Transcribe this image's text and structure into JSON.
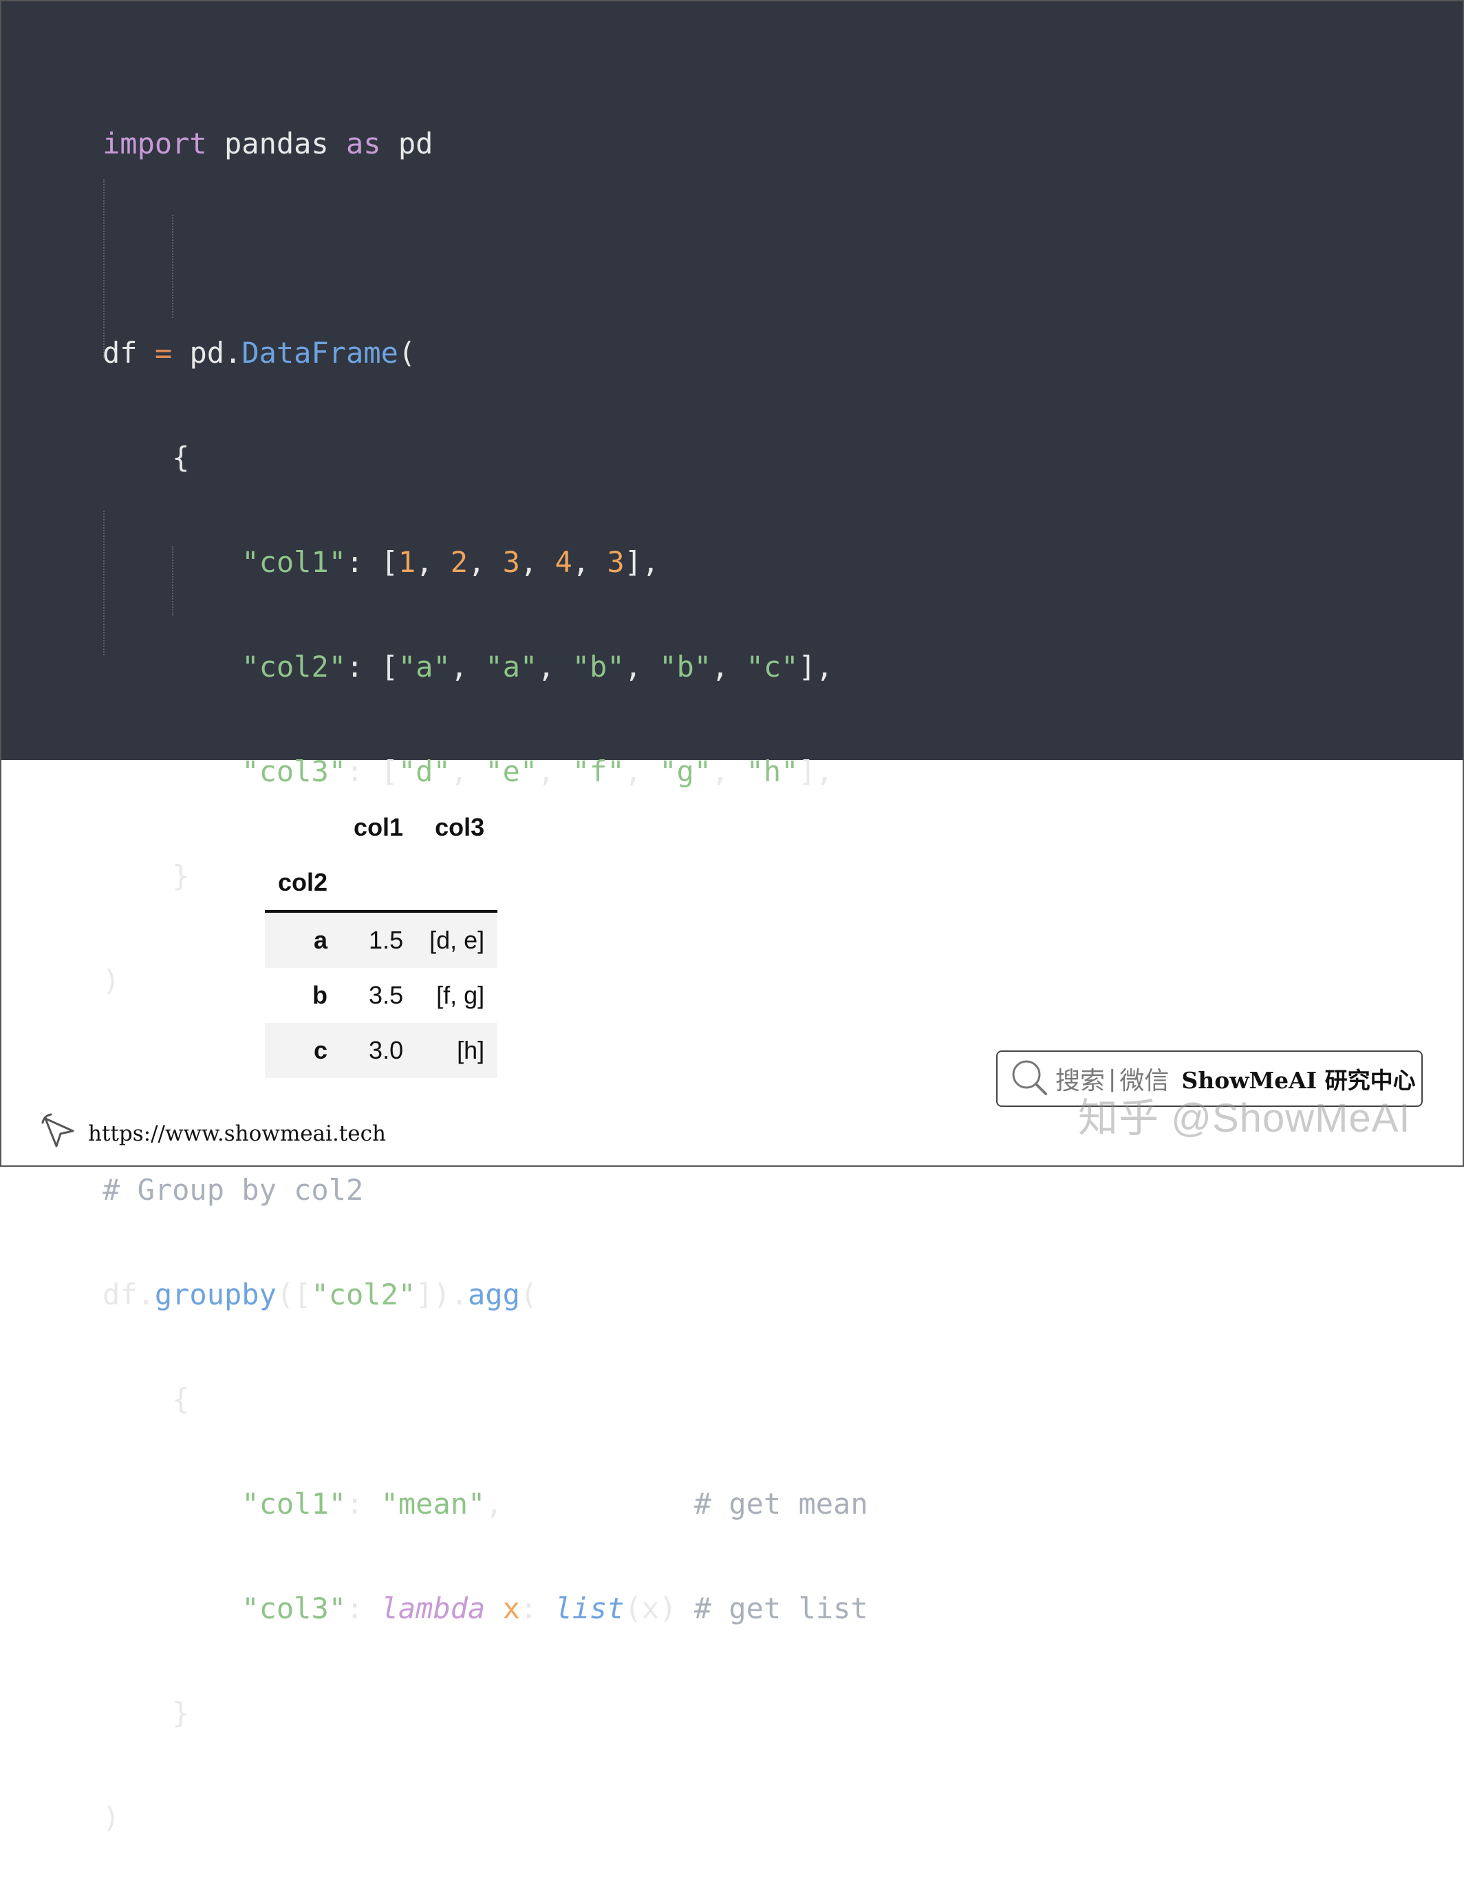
{
  "code": {
    "l1_kw_import": "import",
    "l1_mod": " pandas ",
    "l1_kw_as": "as",
    "l1_alias": " pd",
    "l3_df": "df ",
    "l3_eq": "=",
    "l3_pd": " pd.",
    "l3_fn": "DataFrame",
    "l3_paren": "(",
    "brace_open": "{",
    "brace_close": "}",
    "paren_close": ")",
    "k_col1": "\"col1\"",
    "k_col2": "\"col2\"",
    "k_col3": "\"col3\"",
    "colon": ": ",
    "col1_values": [
      "1",
      "2",
      "3",
      "4",
      "3"
    ],
    "col2_values": [
      "\"a\"",
      "\"a\"",
      "\"b\"",
      "\"b\"",
      "\"c\""
    ],
    "col3_values": [
      "\"d\"",
      "\"e\"",
      "\"f\"",
      "\"g\"",
      "\"h\""
    ],
    "comment_group": "# Group by col2",
    "l13_df": "df.",
    "l13_groupby": "groupby",
    "l13_open": "([",
    "l13_key": "\"col2\"",
    "l13_close": "]).",
    "l13_agg": "agg",
    "l13_paren": "(",
    "agg_mean": "\"mean\"",
    "comment_mean": "# get mean",
    "kw_lambda": "lambda",
    "lambda_var": "x",
    "fn_list": "list",
    "list_arg": "(x)",
    "comment_list": "# get list"
  },
  "table": {
    "columns": [
      "col1",
      "col3"
    ],
    "index_name": "col2",
    "rows": [
      {
        "index": "a",
        "col1": "1.5",
        "col3": "[d, e]"
      },
      {
        "index": "b",
        "col1": "3.5",
        "col3": "[f, g]"
      },
      {
        "index": "c",
        "col1": "3.0",
        "col3": "[h]"
      }
    ]
  },
  "footer": {
    "url": "https://www.showmeai.tech",
    "search_placeholder": "搜索",
    "search_sep": "|",
    "search_wechat": "微信",
    "search_brand": "ShowMeAI 研究中心",
    "watermark": "知乎 @ShowMeAI"
  },
  "icons": {
    "footer": "cursor-pointer-icon",
    "search": "search-icon"
  }
}
